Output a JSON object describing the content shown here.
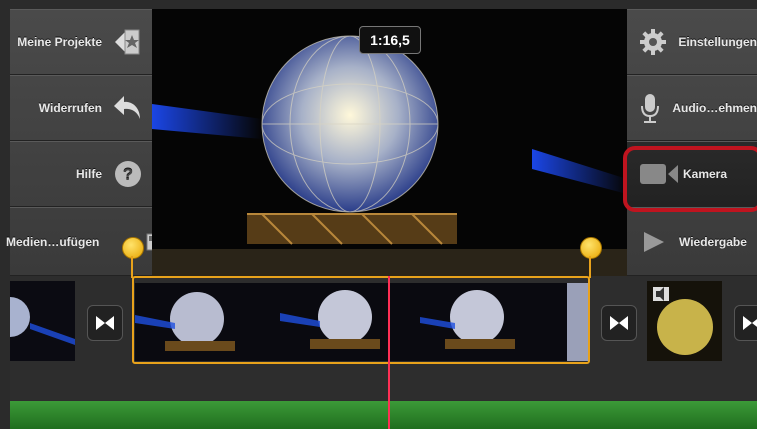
{
  "left_buttons": [
    {
      "label": "Meine Projekte",
      "icon": "star-clapper-icon"
    },
    {
      "label": "Widerrufen",
      "icon": "undo-arrow-icon"
    },
    {
      "label": "Hilfe",
      "icon": "help-icon"
    },
    {
      "label": "Medien…ufügen",
      "icon": "add-media-icon"
    }
  ],
  "right_buttons": [
    {
      "label": "Einstellungen",
      "icon": "gear-icon"
    },
    {
      "label": "Audio…ehmen",
      "icon": "microphone-icon"
    },
    {
      "label": "Kamera",
      "icon": "video-camera-icon"
    },
    {
      "label": "Wiedergabe",
      "icon": "play-icon"
    }
  ],
  "preview": {
    "timecode": "1:16,5"
  },
  "colors": {
    "selection": "#e8a21b",
    "playhead": "#ff2f55",
    "highlight": "#c0141f",
    "audio": "#2f8a2c"
  }
}
